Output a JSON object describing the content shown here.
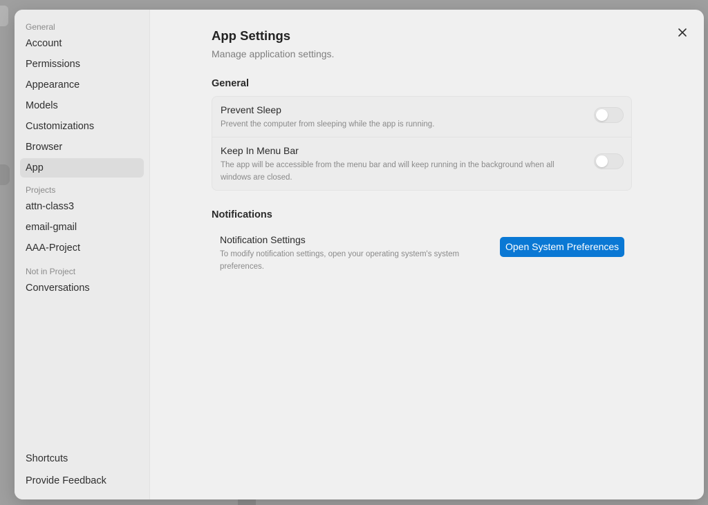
{
  "sidebar": {
    "sections": [
      {
        "label": "General",
        "items": [
          "Account",
          "Permissions",
          "Appearance",
          "Models",
          "Customizations",
          "Browser",
          "App"
        ]
      },
      {
        "label": "Projects",
        "items": [
          "attn-class3",
          "email-gmail",
          "AAA-Project"
        ]
      },
      {
        "label": "Not in Project",
        "items": [
          "Conversations"
        ]
      }
    ],
    "active_item": "App",
    "bottom_items": [
      "Shortcuts",
      "Provide Feedback"
    ]
  },
  "main": {
    "title": "App Settings",
    "subtitle": "Manage application settings.",
    "general": {
      "heading": "General",
      "rows": [
        {
          "title": "Prevent Sleep",
          "description": "Prevent the computer from sleeping while the app is running.",
          "toggle_on": false
        },
        {
          "title": "Keep In Menu Bar",
          "description": "The app will be accessible from the menu bar and will keep running in the background when all windows are closed.",
          "toggle_on": false
        }
      ]
    },
    "notifications": {
      "heading": "Notifications",
      "title": "Notification Settings",
      "description": "To modify notification settings, open your operating system's system preferences.",
      "button_label": "Open System Preferences"
    }
  },
  "icons": {
    "close": "close-icon"
  },
  "colors": {
    "accent": "#0a78d4",
    "modal_bg": "#f0f0f0",
    "sidebar_bg": "#ebebeb",
    "active_item_bg": "#dcdcdc"
  }
}
